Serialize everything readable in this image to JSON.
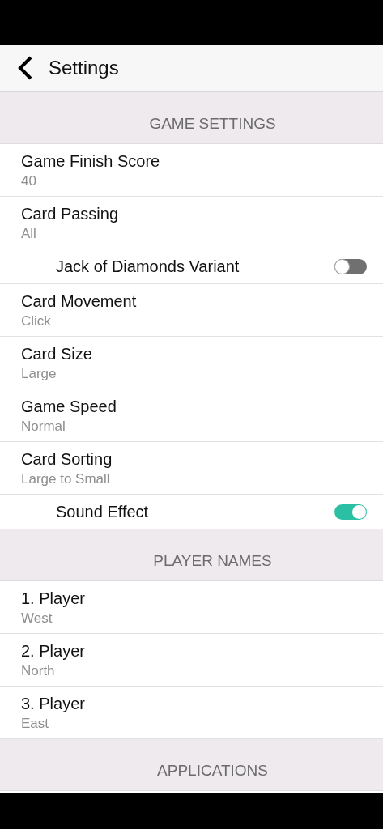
{
  "nav_bar": {
    "title": "Settings"
  },
  "sections": [
    {
      "title": "GAME SETTINGS",
      "items": [
        {
          "kind": "value",
          "label": "Game Finish Score",
          "value": "40"
        },
        {
          "kind": "value",
          "label": "Card Passing",
          "value": "All"
        },
        {
          "kind": "toggle",
          "label": "Jack of Diamonds Variant",
          "on": false
        },
        {
          "kind": "value",
          "label": "Card Movement",
          "value": "Click"
        },
        {
          "kind": "value",
          "label": "Card Size",
          "value": "Large"
        },
        {
          "kind": "value",
          "label": "Game Speed",
          "value": "Normal"
        },
        {
          "kind": "value",
          "label": "Card Sorting",
          "value": "Large to Small"
        },
        {
          "kind": "toggle",
          "label": "Sound Effect",
          "on": true
        }
      ]
    },
    {
      "title": "PLAYER NAMES",
      "items": [
        {
          "kind": "value",
          "label": "1. Player",
          "value": "West"
        },
        {
          "kind": "value",
          "label": "2. Player",
          "value": "North"
        },
        {
          "kind": "value",
          "label": "3. Player",
          "value": "East"
        }
      ]
    },
    {
      "title": "APPLICATIONS"
    }
  ]
}
